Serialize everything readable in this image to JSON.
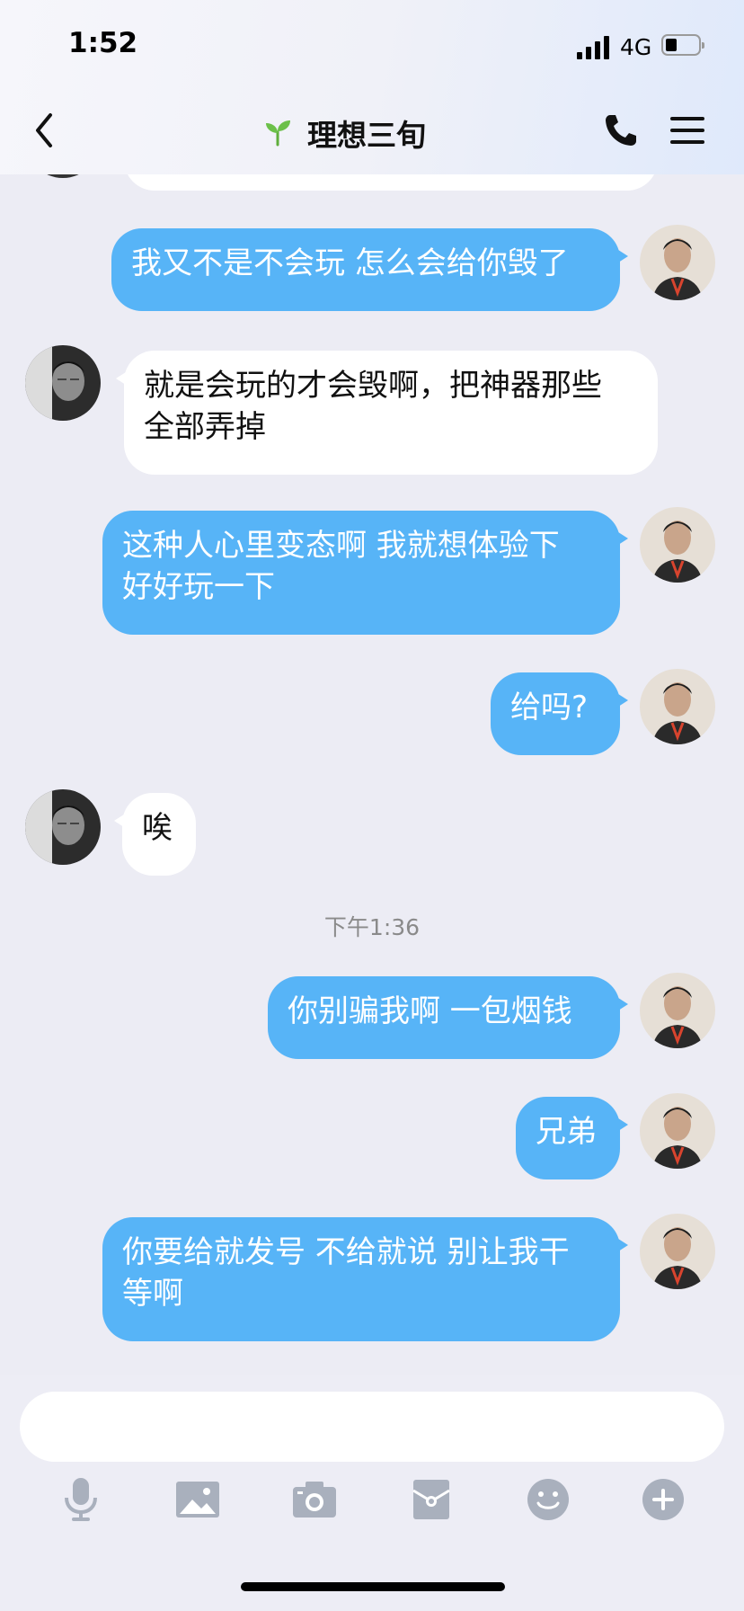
{
  "status": {
    "time": "1:52",
    "network": "4G"
  },
  "header": {
    "title": "理想三旬"
  },
  "messages": [
    {
      "side": "me",
      "text": "我又不是不会玩 怎么会给你毁了"
    },
    {
      "side": "them",
      "text": "就是会玩的才会毁啊，把神器那些\n全部弄掉"
    },
    {
      "side": "me",
      "text": "这种人心里变态啊 我就想体验下\n好好玩一下"
    },
    {
      "side": "me",
      "text": "给吗?"
    },
    {
      "side": "them",
      "text": "唉"
    },
    {
      "side": "me",
      "text": "你别骗我啊 一包烟钱"
    },
    {
      "side": "me",
      "text": "兄弟"
    },
    {
      "side": "me",
      "text": "你要给就发号 不给就说 别让我干\n等啊"
    }
  ],
  "timestamp": "下午1:36",
  "input": {
    "placeholder": ""
  },
  "toolbar": [
    "mic-icon",
    "image-icon",
    "camera-icon",
    "red-packet-icon",
    "emoji-icon",
    "plus-icon"
  ],
  "colors": {
    "bubble_me": "#57B4F7",
    "bubble_them": "#FFFFFF",
    "background": "#ECECF4",
    "icon": "#A9B0BD"
  }
}
